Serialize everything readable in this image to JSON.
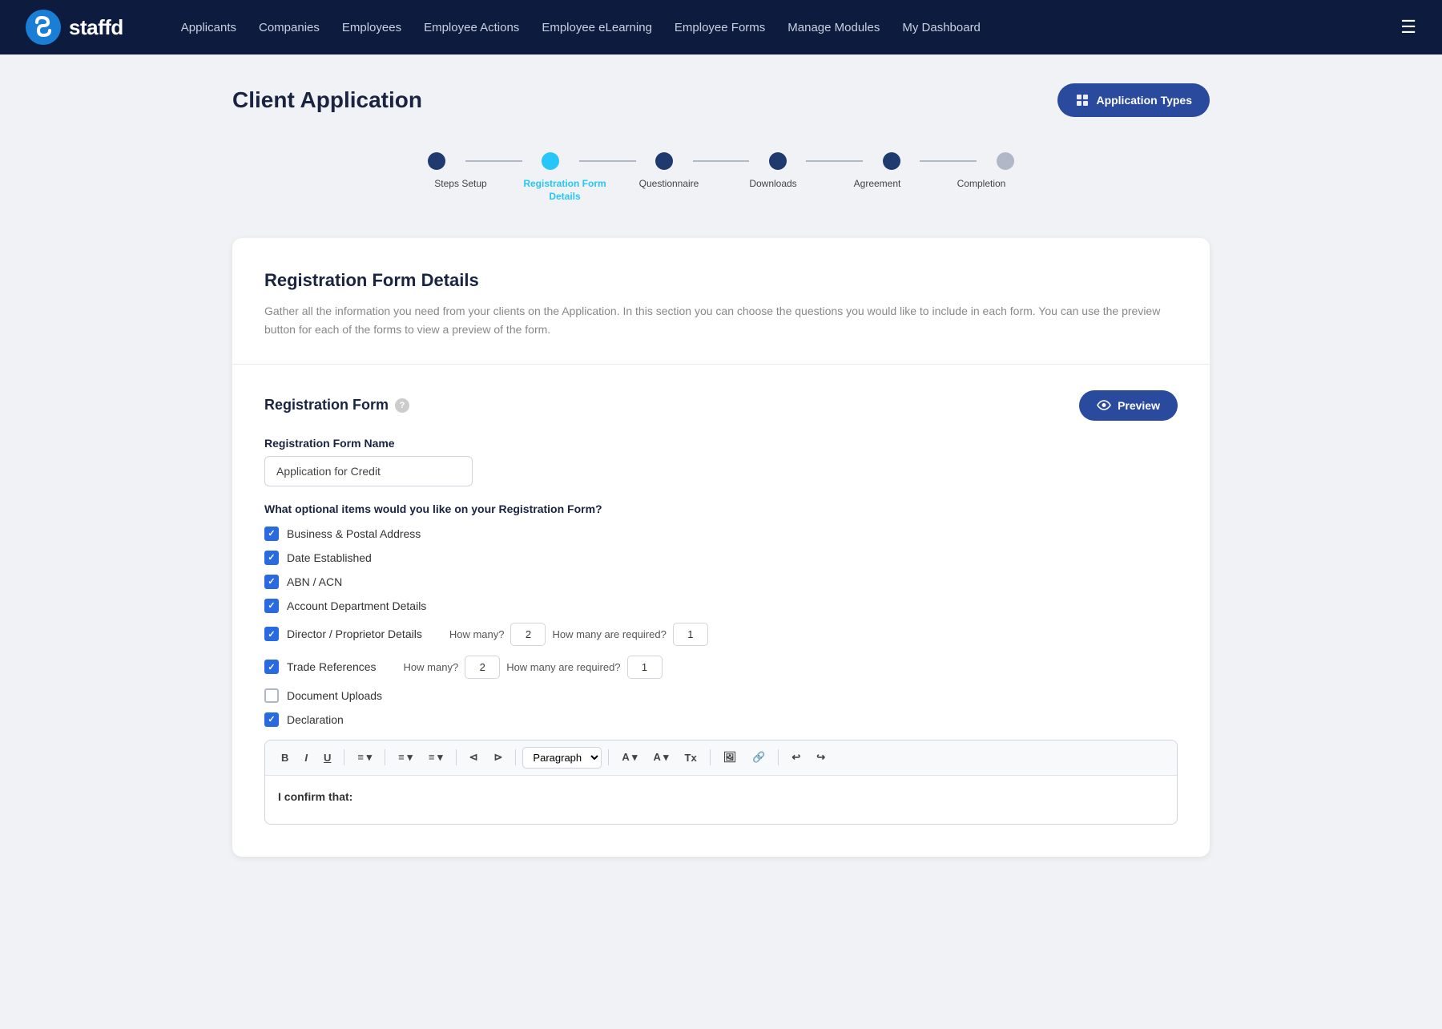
{
  "navbar": {
    "brand": "staffd",
    "links": [
      {
        "label": "Applicants",
        "id": "applicants"
      },
      {
        "label": "Companies",
        "id": "companies"
      },
      {
        "label": "Employees",
        "id": "employees"
      },
      {
        "label": "Employee Actions",
        "id": "employee-actions"
      },
      {
        "label": "Employee eLearning",
        "id": "employee-elearning"
      },
      {
        "label": "Employee Forms",
        "id": "employee-forms"
      },
      {
        "label": "Manage Modules",
        "id": "manage-modules"
      },
      {
        "label": "My Dashboard",
        "id": "my-dashboard"
      }
    ]
  },
  "page": {
    "title": "Client Application",
    "application_types_button": "Application Types"
  },
  "stepper": {
    "steps": [
      {
        "label": "Steps Setup",
        "state": "dark-blue"
      },
      {
        "label": "Registration Form Details",
        "state": "cyan"
      },
      {
        "label": "Questionnaire",
        "state": "dark-blue"
      },
      {
        "label": "Downloads",
        "state": "dark-blue"
      },
      {
        "label": "Agreement",
        "state": "dark-blue"
      },
      {
        "label": "Completion",
        "state": "gray"
      }
    ]
  },
  "card": {
    "title": "Registration Form Details",
    "description": "Gather all the information you need from your clients on the Application. In this section you can choose the questions you would like to include in each form. You can use the preview button for each of the forms to view a preview of the form.",
    "registration_form": {
      "section_title": "Registration Form",
      "preview_button": "Preview",
      "field_label": "Registration Form Name",
      "field_value": "Application for Credit",
      "optional_label": "What optional items would you like on your Registration Form?",
      "checkboxes": [
        {
          "label": "Business & Postal Address",
          "checked": true,
          "has_quantity": false
        },
        {
          "label": "Date Established",
          "checked": true,
          "has_quantity": false
        },
        {
          "label": "ABN / ACN",
          "checked": true,
          "has_quantity": false
        },
        {
          "label": "Account Department Details",
          "checked": true,
          "has_quantity": false
        },
        {
          "label": "Director / Proprietor Details",
          "checked": true,
          "has_quantity": true,
          "how_many": 2,
          "how_many_required": 1
        },
        {
          "label": "Trade References",
          "checked": true,
          "has_quantity": true,
          "how_many": 2,
          "how_many_required": 1
        },
        {
          "label": "Document Uploads",
          "checked": false,
          "has_quantity": false
        },
        {
          "label": "Declaration",
          "checked": true,
          "has_quantity": false
        }
      ],
      "how_many_label": "How many?",
      "how_many_required_label": "How many are required?",
      "editor": {
        "toolbar": {
          "bold": "B",
          "italic": "I",
          "underline": "U",
          "align": "≡",
          "list_ordered": "≡",
          "list_unordered": "≡",
          "outdent": "⊲",
          "indent": "⊳",
          "paragraph": "Paragraph",
          "undo": "↩",
          "redo": "↪"
        },
        "body_text": "I confirm that:"
      }
    }
  }
}
